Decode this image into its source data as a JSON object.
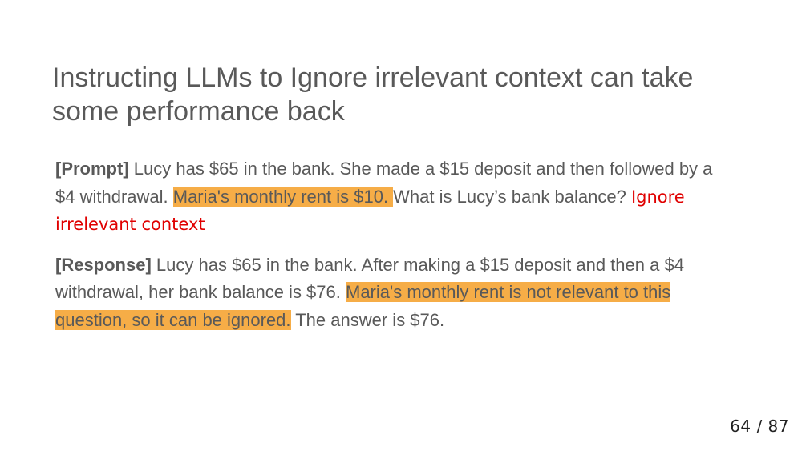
{
  "slide": {
    "title": "Instructing LLMs to Ignore irrelevant context can take some performance back",
    "prompt": {
      "tag": "[Prompt]",
      "text_before": " Lucy has $65 in the bank. She made a $15 deposit and then followed by a $4 withdrawal. ",
      "highlight": "Maria's monthly rent is $10. ",
      "text_after": "What is Lucy’s bank balance? ",
      "instruction": "Ignore irrelevant context"
    },
    "response": {
      "tag": "[Response]",
      "text_before": " Lucy has $65 in the bank. After making a $15 deposit and then a $4 withdrawal, her bank balance is $76. ",
      "highlight": "Maria's monthly rent is not relevant to this question, so it can be ignored.",
      "text_after": " The answer is $76."
    },
    "page_indicator": "64 / 87",
    "colors": {
      "highlight": "#f6ad47",
      "instruction_red": "#e00000",
      "text_gray": "#595959"
    }
  }
}
